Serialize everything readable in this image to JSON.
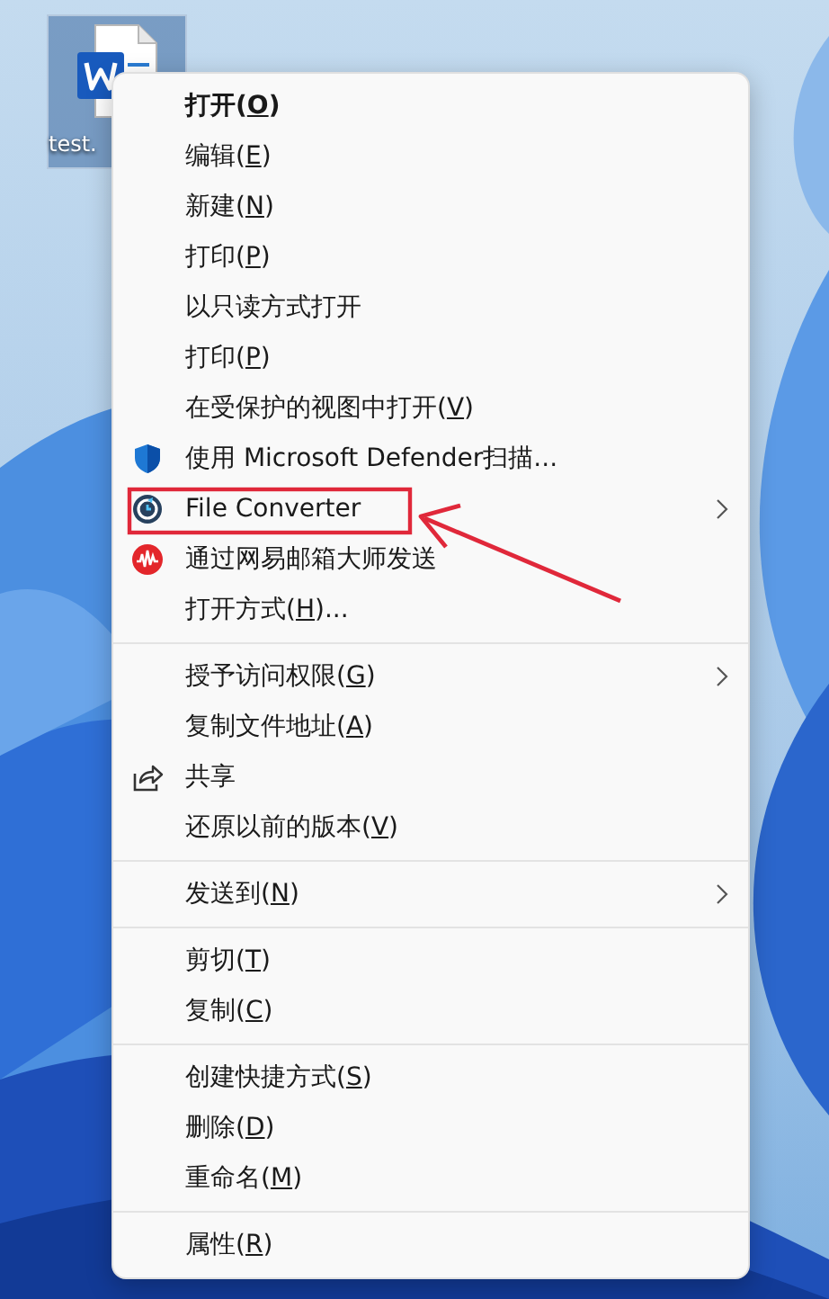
{
  "desktop_icon": {
    "label": "test.",
    "selected": true
  },
  "context_menu": {
    "sections": [
      {
        "items": [
          {
            "kind": "none",
            "label": "打开(",
            "key": "O",
            "tail": ")",
            "default": true,
            "submenu": false
          },
          {
            "kind": "none",
            "label": "编辑(",
            "key": "E",
            "tail": ")",
            "default": false,
            "submenu": false
          },
          {
            "kind": "none",
            "label": "新建(",
            "key": "N",
            "tail": ")",
            "default": false,
            "submenu": false
          },
          {
            "kind": "none",
            "label": "打印(",
            "key": "P",
            "tail": ")",
            "default": false,
            "submenu": false
          },
          {
            "kind": "none",
            "label": "以只读方式打开",
            "default": false,
            "submenu": false
          },
          {
            "kind": "none",
            "label": "打印(",
            "key": "P",
            "tail": ")",
            "default": false,
            "submenu": false
          },
          {
            "kind": "none",
            "label": "在受保护的视图中打开(",
            "key": "V",
            "tail": ")",
            "default": false,
            "submenu": false
          },
          {
            "kind": "shield",
            "label": "使用 Microsoft Defender扫描...",
            "default": false,
            "submenu": false
          },
          {
            "kind": "converter",
            "label": "File Converter",
            "default": false,
            "submenu": true
          },
          {
            "kind": "mail",
            "label": "通过网易邮箱大师发送",
            "default": false,
            "submenu": false
          },
          {
            "kind": "none",
            "label": "打开方式(",
            "key": "H",
            "tail": ")...",
            "default": false,
            "submenu": false
          }
        ]
      },
      {
        "items": [
          {
            "kind": "none",
            "label": "授予访问权限(",
            "key": "G",
            "tail": ")",
            "default": false,
            "submenu": true
          },
          {
            "kind": "none",
            "label": "复制文件地址(",
            "key": "A",
            "tail": ")",
            "default": false,
            "submenu": false
          },
          {
            "kind": "share",
            "label": "共享",
            "default": false,
            "submenu": false
          },
          {
            "kind": "none",
            "label": "还原以前的版本(",
            "key": "V",
            "tail": ")",
            "default": false,
            "submenu": false
          }
        ]
      },
      {
        "items": [
          {
            "kind": "none",
            "label": "发送到(",
            "key": "N",
            "tail": ")",
            "default": false,
            "submenu": true
          }
        ]
      },
      {
        "items": [
          {
            "kind": "none",
            "label": "剪切(",
            "key": "T",
            "tail": ")",
            "default": false,
            "submenu": false
          },
          {
            "kind": "none",
            "label": "复制(",
            "key": "C",
            "tail": ")",
            "default": false,
            "submenu": false
          }
        ]
      },
      {
        "items": [
          {
            "kind": "none",
            "label": "创建快捷方式(",
            "key": "S",
            "tail": ")",
            "default": false,
            "submenu": false
          },
          {
            "kind": "none",
            "label": "删除(",
            "key": "D",
            "tail": ")",
            "default": false,
            "submenu": false
          },
          {
            "kind": "none",
            "label": "重命名(",
            "key": "M",
            "tail": ")",
            "default": false,
            "submenu": false
          }
        ]
      },
      {
        "items": [
          {
            "kind": "none",
            "label": "属性(",
            "key": "R",
            "tail": ")",
            "default": false,
            "submenu": false
          }
        ]
      }
    ]
  }
}
